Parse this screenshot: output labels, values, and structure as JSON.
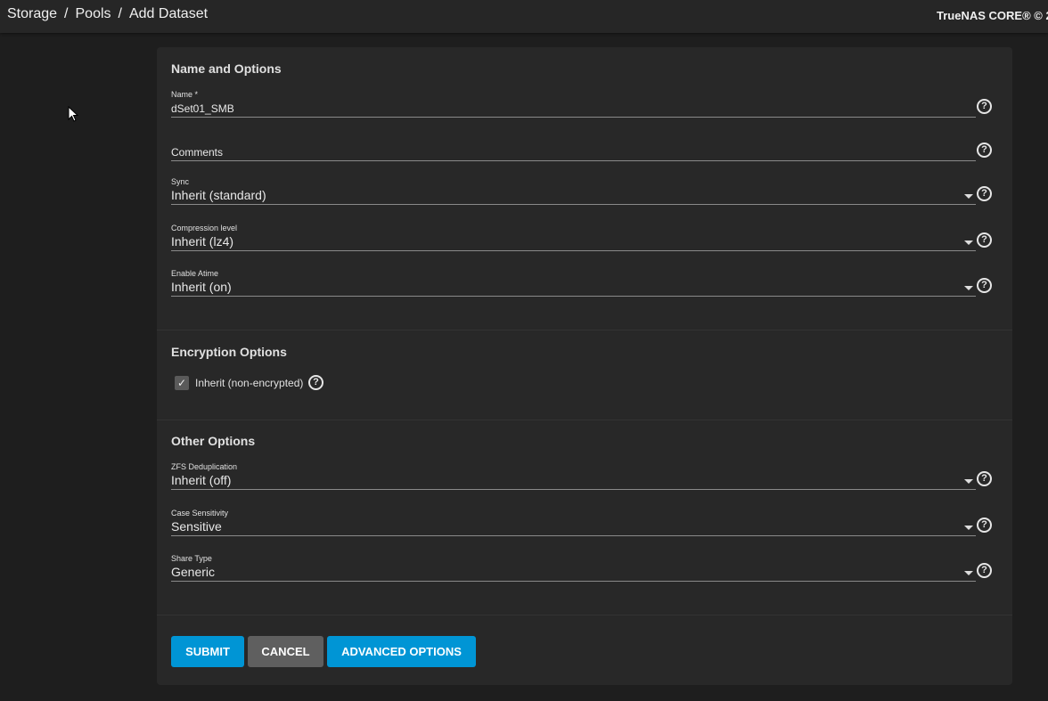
{
  "header": {
    "breadcrumbs": [
      "Storage",
      "Pools",
      "Add Dataset"
    ],
    "brand": "TrueNAS CORE® © 2"
  },
  "sections": {
    "name_options": {
      "title": "Name and Options",
      "name": {
        "label": "Name *",
        "value": "dSet01_SMB"
      },
      "comments": {
        "placeholder": "Comments"
      },
      "sync": {
        "label": "Sync",
        "value": "Inherit (standard)"
      },
      "compression": {
        "label": "Compression level",
        "value": "Inherit (lz4)"
      },
      "atime": {
        "label": "Enable Atime",
        "value": "Inherit (on)"
      }
    },
    "encryption": {
      "title": "Encryption Options",
      "inherit": {
        "label": "Inherit (non-encrypted)",
        "checked": true
      }
    },
    "other": {
      "title": "Other Options",
      "dedup": {
        "label": "ZFS Deduplication",
        "value": "Inherit (off)"
      },
      "case": {
        "label": "Case Sensitivity",
        "value": "Sensitive"
      },
      "share": {
        "label": "Share Type",
        "value": "Generic"
      }
    }
  },
  "buttons": {
    "submit": "SUBMIT",
    "cancel": "CANCEL",
    "advanced": "ADVANCED OPTIONS"
  },
  "colors": {
    "primary": "#0095d5",
    "cancel": "#5f5f5f"
  },
  "help_glyph": "?",
  "check_glyph": "✓"
}
